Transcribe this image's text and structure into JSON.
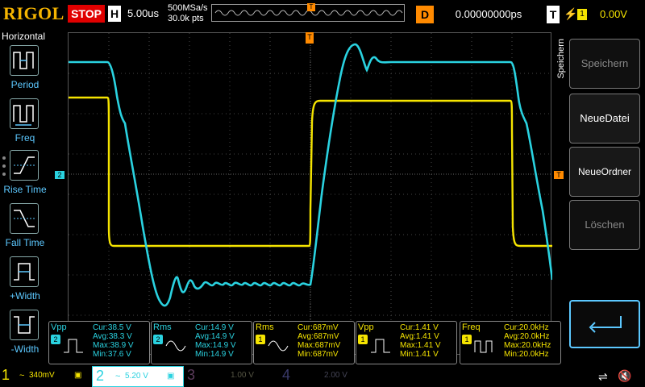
{
  "topbar": {
    "brand": "RIGOL",
    "run_state": "STOP",
    "timebase_label": "H",
    "timebase_value": "5.00us",
    "sample_rate": "500MSa/s",
    "memory_depth": "30.0k pts",
    "trigger_marker": "T",
    "delay_label": "D",
    "delay_value": "0.00000000ps",
    "trigger_label": "T",
    "trigger_edge": "⚡",
    "trigger_channel": "1",
    "trigger_level": "0.00V"
  },
  "left_menu": {
    "title": "Horizontal",
    "items": [
      {
        "label": "Period",
        "icon": "period-icon"
      },
      {
        "label": "Freq",
        "icon": "freq-icon"
      },
      {
        "label": "Rise Time",
        "icon": "rise-time-icon"
      },
      {
        "label": "Fall Time",
        "icon": "fall-time-icon"
      },
      {
        "label": "+Width",
        "icon": "positive-width-icon"
      },
      {
        "label": "-Width",
        "icon": "negative-width-icon"
      }
    ]
  },
  "markers": {
    "ch2_offset": "2",
    "trigger_top": "T",
    "trigger_right": "T"
  },
  "right_menu": {
    "vertical_label": "Speichern",
    "buttons": [
      {
        "label": "Speichern",
        "state": "disabled"
      },
      {
        "label": "NeueDatei",
        "state": "enabled"
      },
      {
        "label": "NeueOrdner",
        "state": "enabled"
      },
      {
        "label": "Löschen",
        "state": "disabled"
      }
    ],
    "enter_icon": "enter-arrow-icon"
  },
  "measurements": [
    {
      "name": "Vpp",
      "channel": "2",
      "color": "#2ad2e0",
      "cur": "Cur:38.5 V",
      "avg": "Avg:38.3 V",
      "max": "Max:38.9 V",
      "min": "Min:37.6 V"
    },
    {
      "name": "Rms",
      "channel": "2",
      "color": "#2ad2e0",
      "cur": "Cur:14.9 V",
      "avg": "Avg:14.9 V",
      "max": "Max:14.9 V",
      "min": "Min:14.9 V"
    },
    {
      "name": "Rms",
      "channel": "1",
      "color": "#f5e400",
      "cur": "Cur:687mV",
      "avg": "Avg:687mV",
      "max": "Max:687mV",
      "min": "Min:687mV"
    },
    {
      "name": "Vpp",
      "channel": "1",
      "color": "#f5e400",
      "cur": "Cur:1.41 V",
      "avg": "Avg:1.41 V",
      "max": "Max:1.41 V",
      "min": "Min:1.41 V"
    },
    {
      "name": "Freq",
      "channel": "1",
      "color": "#f5e400",
      "cur": "Cur:20.0kHz",
      "avg": "Avg:20.0kHz",
      "max": "Max:20.0kHz",
      "min": "Min:20.0kHz"
    }
  ],
  "channels": [
    {
      "num": "1",
      "coupling": "~",
      "scale": "340mV",
      "color": "#f5e400"
    },
    {
      "num": "2",
      "coupling": "~",
      "scale": "5.20 V",
      "color": "#2ad2e0"
    },
    {
      "num": "3",
      "coupling": "",
      "scale": "1.00 V",
      "color": "#5a3a5a"
    },
    {
      "num": "4",
      "coupling": "",
      "scale": "2.00 V",
      "color": "#3a3a6a"
    }
  ],
  "status_icons": {
    "usb": "usb-icon",
    "speaker": "speaker-muted-icon"
  },
  "colors": {
    "ch1": "#f5e400",
    "ch2": "#2ad2e0",
    "trigger": "#ff8a00",
    "stop": "#e00000",
    "brand": "#f5b400"
  }
}
